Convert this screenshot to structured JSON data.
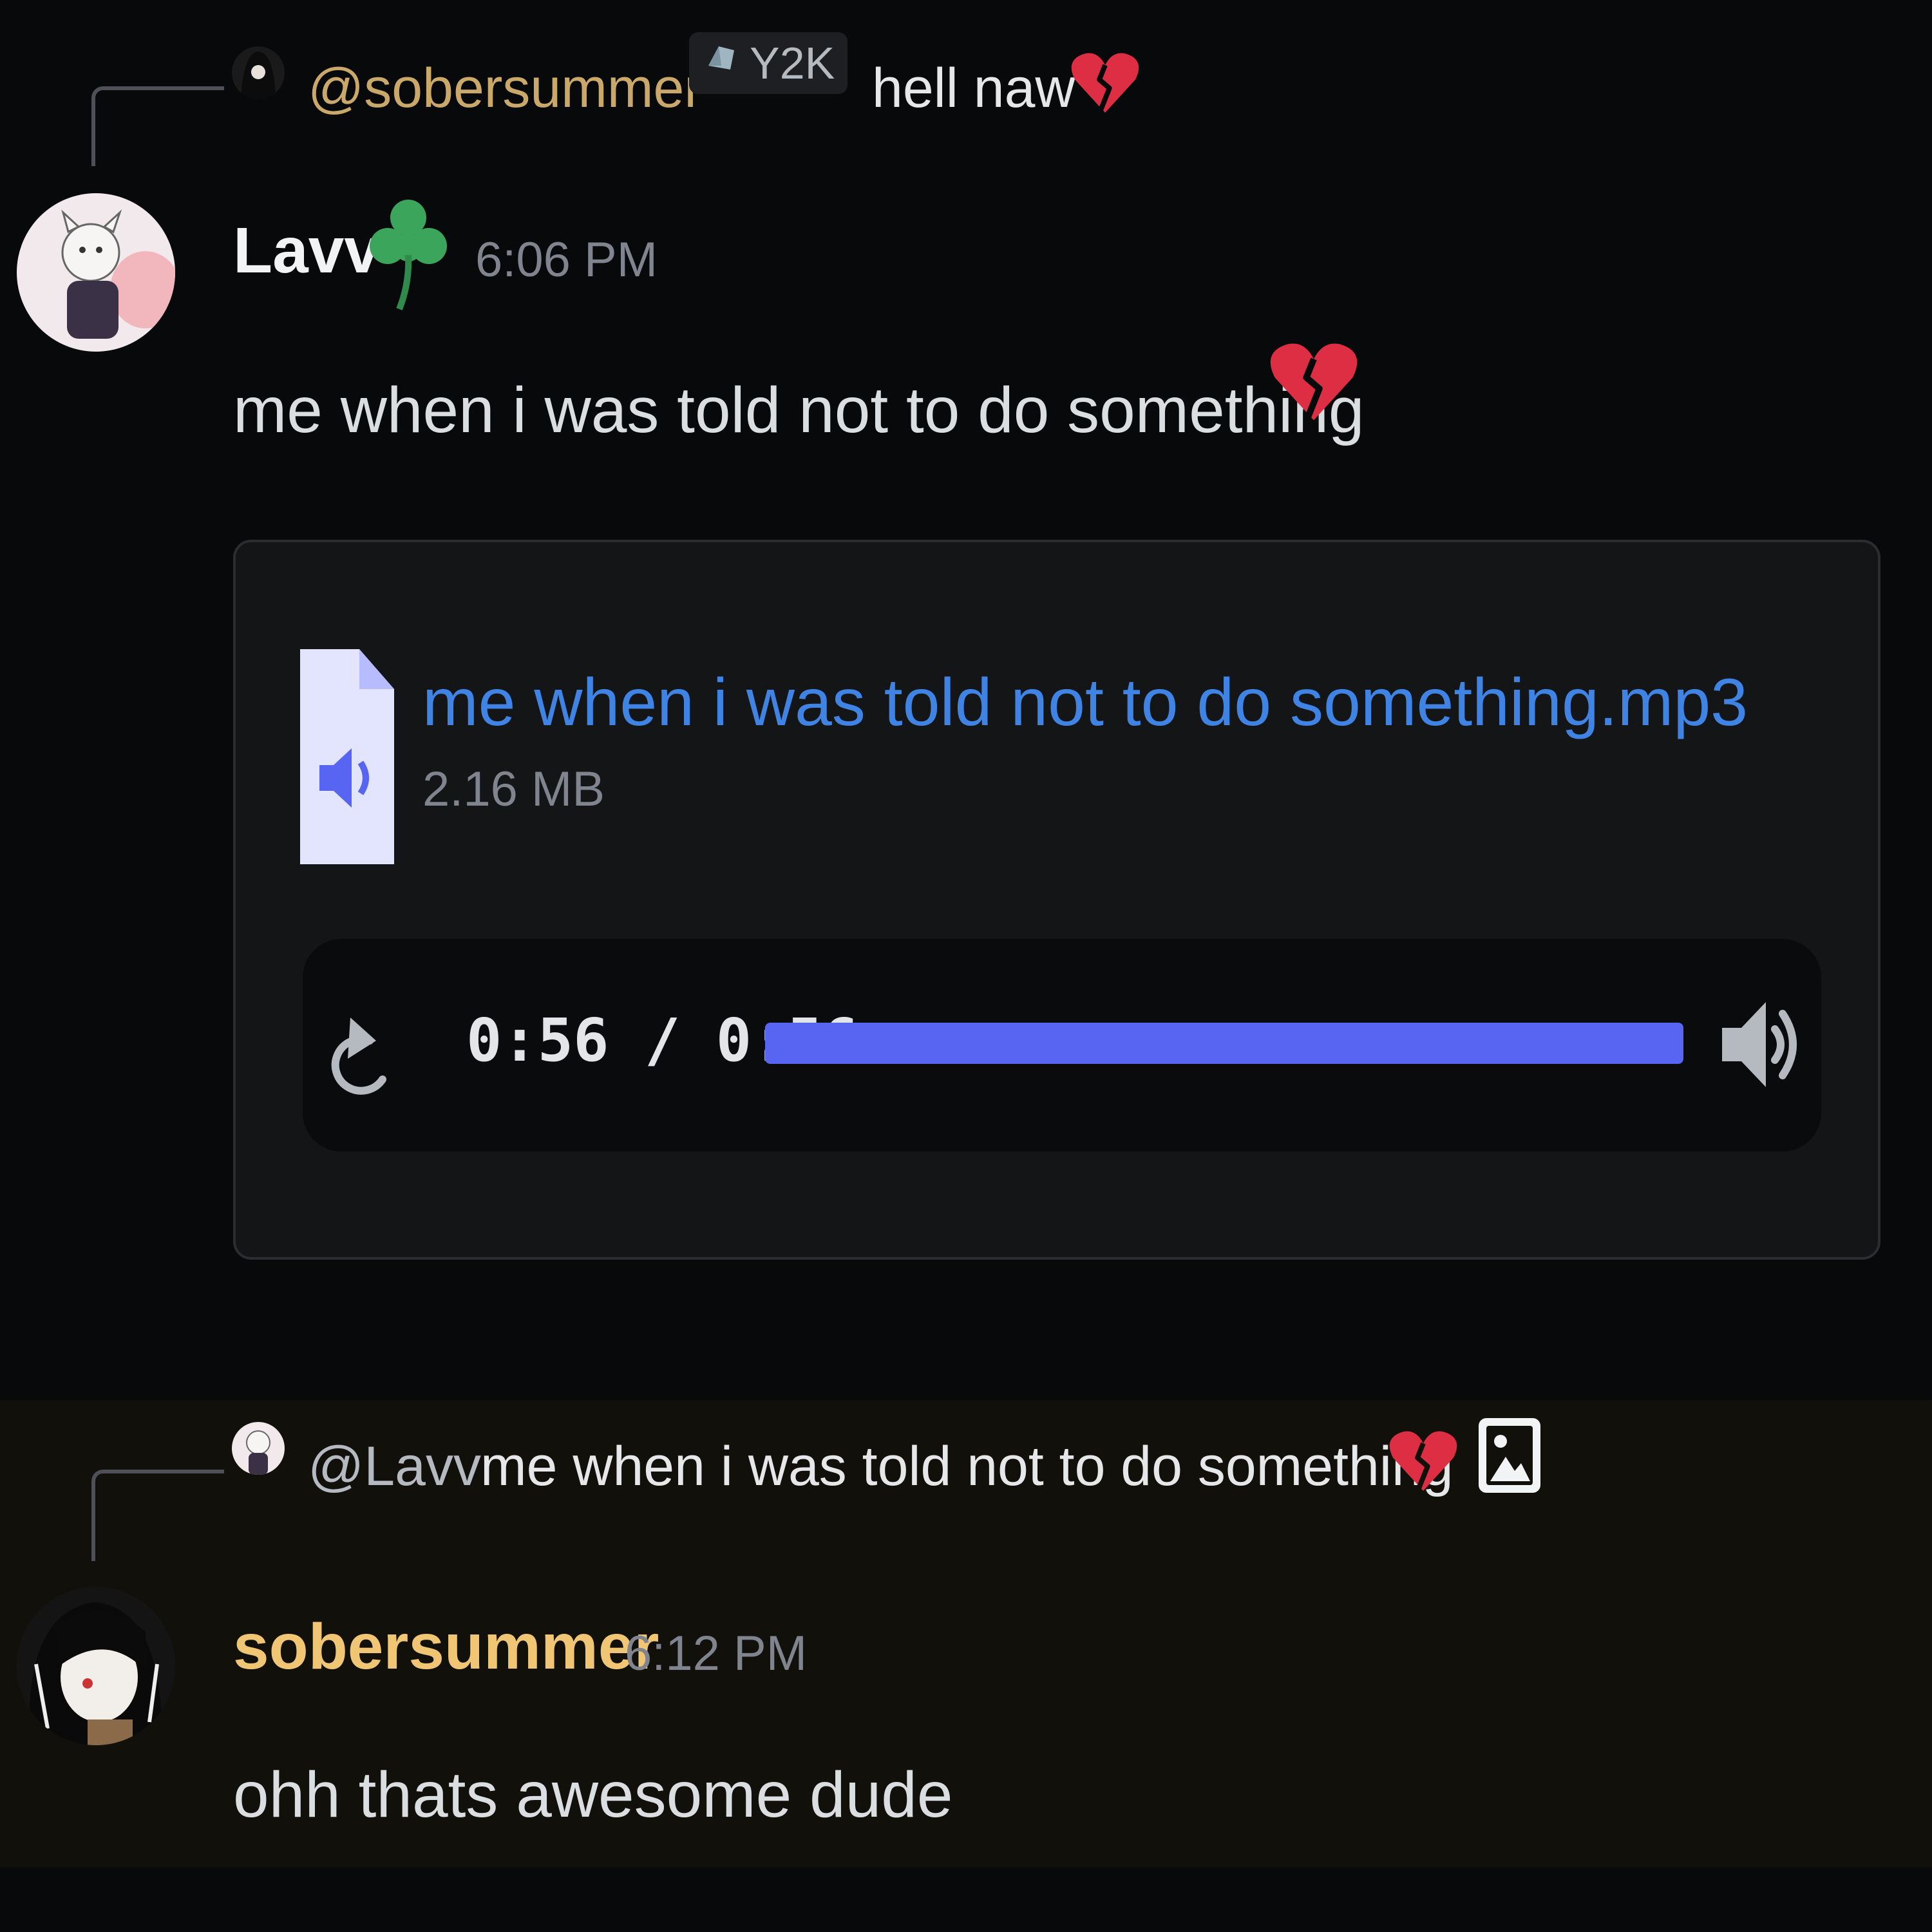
{
  "messages": [
    {
      "reply": {
        "mention": "@sobersummer",
        "tag": "Y2K",
        "text": "hell naw",
        "emoji": "broken-heart"
      },
      "author": "Lavv",
      "author_badge": "shamrock-icon",
      "timestamp": "6:06 PM",
      "content": "me when i was told not to do something",
      "content_emoji": "broken-heart",
      "attachment": {
        "filename": "me when i was told not to do something.mp3",
        "size": "2.16 MB",
        "player": {
          "time": "0:56 / 0:56",
          "progress": 1.0
        }
      }
    },
    {
      "reply": {
        "mention": "@Lavv",
        "text": "me when i was told not to do something",
        "emoji": "broken-heart",
        "attachment_icon": "image-icon"
      },
      "author": "sobersummer",
      "timestamp": "6:12 PM",
      "content": "ohh thats awesome dude"
    }
  ],
  "colors": {
    "background": "#08090b",
    "highlight": "#12100b",
    "mention_gold": "#c9a86a",
    "author_gold": "#f0c674",
    "link": "#3f84e5",
    "progress": "#5865f2",
    "broken_heart": "#dd2e44",
    "shamrock": "#3ba55c"
  }
}
